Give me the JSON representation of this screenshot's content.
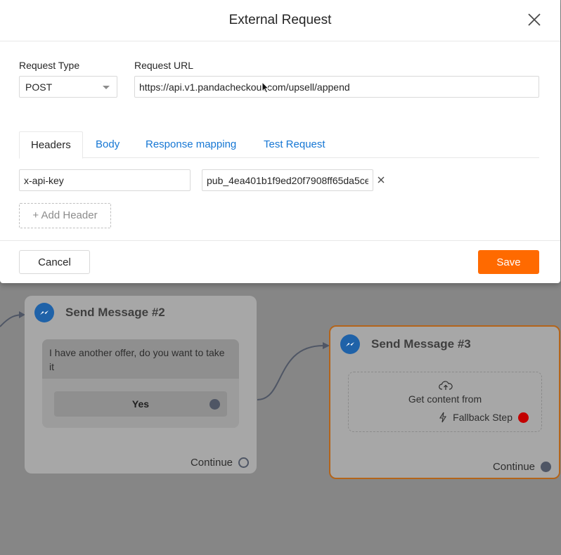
{
  "modal": {
    "title": "External Request",
    "request_type_label": "Request Type",
    "request_type_value": "POST",
    "request_url_label": "Request URL",
    "request_url_value": "https://api.v1.pandacheckout.com/upsell/append",
    "tabs": [
      {
        "label": "Headers",
        "active": true
      },
      {
        "label": "Body",
        "active": false
      },
      {
        "label": "Response mapping",
        "active": false
      },
      {
        "label": "Test Request",
        "active": false
      }
    ],
    "headers": [
      {
        "key": "x-api-key",
        "value": "pub_4ea401b1f9ed20f7908ff65da5ce"
      }
    ],
    "add_header_label": "+ Add Header",
    "cancel_label": "Cancel",
    "save_label": "Save"
  },
  "canvas": {
    "nodes": [
      {
        "title": "Send Message #2",
        "message": "I have another offer, do you want to take it",
        "button_label": "Yes",
        "continue_label": "Continue"
      },
      {
        "title": "Send Message #3",
        "content_label": "Get content from",
        "fallback_label": "Fallback Step",
        "continue_label": "Continue"
      }
    ]
  },
  "colors": {
    "accent_link": "#1677d4",
    "save_button": "#ff6a00",
    "canvas_background": "#868686",
    "selected_node_border": "#b3641a",
    "fallback_port": "#c30000",
    "messenger_icon": "#1f62a8"
  }
}
